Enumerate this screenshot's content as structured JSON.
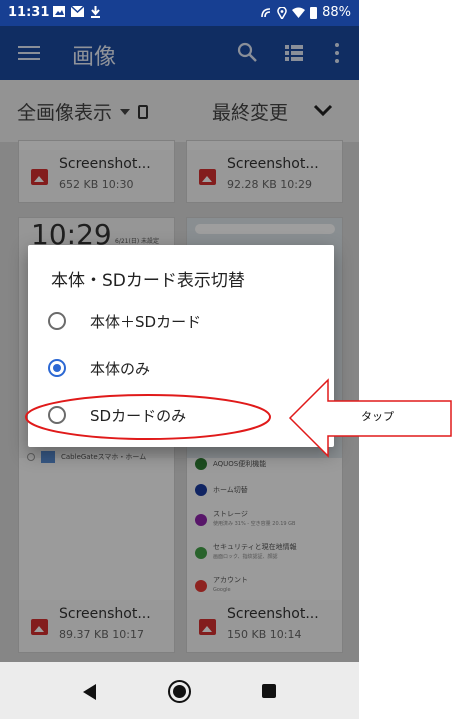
{
  "status_bar": {
    "time": "11:31",
    "battery": "88%",
    "left_icons": [
      "image-notification-icon",
      "mail-icon",
      "download-icon"
    ],
    "right_icons": [
      "nfc-icon",
      "location-icon",
      "wifi-icon",
      "battery-icon"
    ]
  },
  "app_bar": {
    "title": "画像",
    "icons": [
      "menu-icon",
      "search-icon",
      "list-view-icon",
      "more-vert-icon"
    ],
    "color": "#1b4a9f"
  },
  "toolbar": {
    "view_select": "全画像表示",
    "storage_icon": "phone-storage-icon",
    "sort_label": "最終変更",
    "sort_icon": "chevron-down-icon"
  },
  "grid": {
    "top_cards": [
      {
        "name": "Screenshot...",
        "info": "652 KB 10:30"
      },
      {
        "name": "Screenshot...",
        "info": "92.28 KB 10:29"
      }
    ],
    "bottom_cards": [
      {
        "name": "Screenshot...",
        "info": "89.37 KB 10:17"
      },
      {
        "name": "Screenshot...",
        "info": "150 KB 10:14"
      }
    ],
    "lock_time": "10:29",
    "lock_date": "6/21(日)",
    "lock_weather": "未設定",
    "left_app_label": "CableGateスマホ・ホーム",
    "settings_items": [
      {
        "title": "AQUOS便利機能",
        "sub": ""
      },
      {
        "title": "ホーム切替",
        "sub": ""
      },
      {
        "title": "ストレージ",
        "sub": "使用済み 31% - 空き容量 20.19 GB"
      },
      {
        "title": "セキュリティと現在地情報",
        "sub": "画面ロック、指紋認証、顔認"
      },
      {
        "title": "アカウント",
        "sub": "Google"
      }
    ]
  },
  "dialog": {
    "title": "本体・SDカード表示切替",
    "options": [
      {
        "label": "本体＋SDカード",
        "selected": false
      },
      {
        "label": "本体のみ",
        "selected": true
      },
      {
        "label": "SDカードのみ",
        "selected": false
      }
    ],
    "accent": "#2c68d3"
  },
  "annotation": {
    "label": "タップ",
    "color": "#e01a1a"
  },
  "nav_bar": {
    "icons": [
      "back-icon",
      "home-icon",
      "recent-apps-icon"
    ]
  }
}
